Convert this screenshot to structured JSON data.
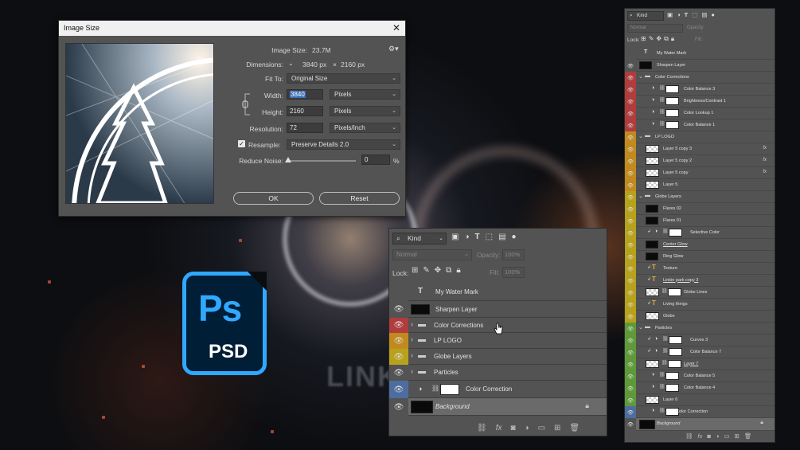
{
  "background": {
    "brand_text": "LINKIN"
  },
  "dialog": {
    "title": "Image Size",
    "image_size_label": "Image Size:",
    "image_size_value": "23.7M",
    "dimensions_label": "Dimensions:",
    "dim_width": "3840 px",
    "dim_sep": "×",
    "dim_height": "2160 px",
    "fit_to_label": "Fit To:",
    "fit_to_value": "Original Size",
    "width_label": "Width:",
    "width_value": "3840",
    "width_unit": "Pixels",
    "height_label": "Height:",
    "height_value": "2160",
    "height_unit": "Pixels",
    "resolution_label": "Resolution:",
    "resolution_value": "72",
    "resolution_unit": "Pixels/Inch",
    "resample_label": "Resample:",
    "resample_value": "Preserve Details 2.0",
    "reduce_noise_label": "Reduce Noise:",
    "reduce_noise_value": "0",
    "reduce_noise_unit": "%",
    "reduce_noise_level": 0,
    "ok_label": "OK",
    "reset_label": "Reset"
  },
  "logo": {
    "ps": "Ps",
    "psd": "PSD"
  },
  "layers_main": {
    "filter_kind": "Kind",
    "blend_mode": "Normal",
    "opacity_label": "Opacity:",
    "opacity_value": "100%",
    "lock_label": "Lock:",
    "fill_label": "Fill:",
    "fill_value": "100%",
    "text_icon": "T",
    "layers": [
      {
        "name": "My Water Mark",
        "color": "#535353"
      },
      {
        "name": "Sharpen Layer",
        "color": "#535353"
      },
      {
        "name": "Color Corrections",
        "color": "#b03c3c"
      },
      {
        "name": "LP LOGO",
        "color": "#c28a1e"
      },
      {
        "name": "Globe Layers",
        "color": "#b8a21c"
      },
      {
        "name": "Particles",
        "color": "#535353"
      },
      {
        "name": "Color Correction",
        "color": "#4d6ca0"
      },
      {
        "name": "Background",
        "color": "#535353"
      }
    ]
  },
  "layers_right": {
    "filter_kind": "Kind",
    "blend_mode": "Normal",
    "opacity_label": "Opacity:",
    "lock_label": "Lock:",
    "fill_label": "Fill:",
    "text_icon": "T",
    "fx_label": "fx",
    "layers": [
      {
        "name": "My Water Mark",
        "color": "#535353"
      },
      {
        "name": "Sharpen Layer",
        "color": "#535353"
      },
      {
        "name": "Color Corrections",
        "color": "#b03c3c"
      },
      {
        "name": "Color Balance 3",
        "color": "#b03c3c"
      },
      {
        "name": "Brightness/Contrast 1",
        "color": "#b03c3c"
      },
      {
        "name": "Color Lookup 1",
        "color": "#b03c3c"
      },
      {
        "name": "Color Balance 1",
        "color": "#b03c3c"
      },
      {
        "name": "LP LOGO",
        "color": "#c28a1e"
      },
      {
        "name": "Layer 5 copy 3",
        "color": "#c28a1e"
      },
      {
        "name": "Layer 5 copy 2",
        "color": "#c28a1e"
      },
      {
        "name": "Layer 5 copy",
        "color": "#c28a1e"
      },
      {
        "name": "Layer 5",
        "color": "#c28a1e"
      },
      {
        "name": "Globe Layers",
        "color": "#b8a21c"
      },
      {
        "name": "Flares 02",
        "color": "#b8a21c"
      },
      {
        "name": "Flares 01",
        "color": "#b8a21c"
      },
      {
        "name": "Selective Color",
        "color": "#b8a21c"
      },
      {
        "name": "Center Glow",
        "color": "#b8a21c"
      },
      {
        "name": "Ring Glow",
        "color": "#b8a21c"
      },
      {
        "name": "Texture",
        "color": "#b8a21c"
      },
      {
        "name": "Linkin park copy 3",
        "color": "#b8a21c"
      },
      {
        "name": "Globe Lines",
        "color": "#b8a21c"
      },
      {
        "name": "Living things",
        "color": "#b8a21c"
      },
      {
        "name": "Globe",
        "color": "#b8a21c"
      },
      {
        "name": "Particles",
        "color": "#5e9a3a"
      },
      {
        "name": "Curves 3",
        "color": "#5e9a3a"
      },
      {
        "name": "Color Balance 7",
        "color": "#5e9a3a"
      },
      {
        "name": "Layer 7",
        "color": "#5e9a3a"
      },
      {
        "name": "Color Balance 5",
        "color": "#5e9a3a"
      },
      {
        "name": "Color Balance 4",
        "color": "#5e9a3a"
      },
      {
        "name": "Layer 6",
        "color": "#5e9a3a"
      },
      {
        "name": "Color Correction",
        "color": "#4d6ca0"
      },
      {
        "name": "Background",
        "color": "#535353"
      }
    ]
  }
}
